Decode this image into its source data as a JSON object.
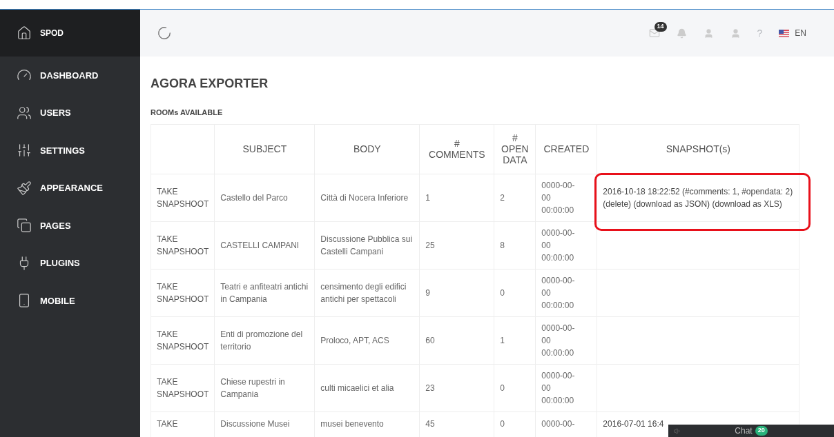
{
  "sidebar": {
    "brand": "SPOD",
    "items": [
      {
        "label": "DASHBOARD",
        "kind": "gauge"
      },
      {
        "label": "USERS",
        "kind": "users"
      },
      {
        "label": "SETTINGS",
        "kind": "sliders"
      },
      {
        "label": "APPEARANCE",
        "kind": "brush"
      },
      {
        "label": "PAGES",
        "kind": "pages"
      },
      {
        "label": "PLUGINS",
        "kind": "plug"
      },
      {
        "label": "MOBILE",
        "kind": "mobile"
      }
    ]
  },
  "topbar": {
    "mail_count": "14",
    "help": "?",
    "language": "EN"
  },
  "page": {
    "title": "AGORA EXPORTER",
    "section": "ROOMs AVAILABLE"
  },
  "table": {
    "columns": [
      [
        "SUBJECT"
      ],
      [
        "BODY"
      ],
      [
        "#",
        "COMMENTS"
      ],
      [
        "#",
        "OPEN",
        "DATA"
      ],
      [
        "CREATED"
      ],
      [
        "SNAPSHOT(s)"
      ]
    ],
    "rows": [
      {
        "action": [
          "TAKE",
          "SNAPSHOOT"
        ],
        "subject": "Castello del Parco",
        "body": "Città di Nocera Inferiore",
        "comments": "1",
        "open_data": "2",
        "created": [
          "0000-00-",
          "00",
          "00:00:00"
        ],
        "snapshot": "2016-10-18 18:22:52 (#comments: 1, #opendata: 2) (delete) (download as JSON) (download as XLS)",
        "highlighted": true
      },
      {
        "action": [
          "TAKE",
          "SNAPSHOOT"
        ],
        "subject": "CASTELLI CAMPANI",
        "body": "Discussione Pubblica sui Castelli Campani",
        "comments": "25",
        "open_data": "8",
        "created": [
          "0000-00-",
          "00",
          "00:00:00"
        ],
        "snapshot": "",
        "highlighted": false
      },
      {
        "action": [
          "TAKE",
          "SNAPSHOOT"
        ],
        "subject": "Teatri e anfiteatri antichi in Campania",
        "body": "censimento degli edifici antichi per spettacoli",
        "comments": "9",
        "open_data": "0",
        "created": [
          "0000-00-",
          "00",
          "00:00:00"
        ],
        "snapshot": "",
        "highlighted": false
      },
      {
        "action": [
          "TAKE",
          "SNAPSHOOT"
        ],
        "subject": "Enti di promozione del territorio",
        "body": "Proloco, APT, ACS",
        "comments": "60",
        "open_data": "1",
        "created": [
          "0000-00-",
          "00",
          "00:00:00"
        ],
        "snapshot": "",
        "highlighted": false
      },
      {
        "action": [
          "TAKE",
          "SNAPSHOOT"
        ],
        "subject": "Chiese rupestri in Campania",
        "body": "culti micaelici et alia",
        "comments": "23",
        "open_data": "0",
        "created": [
          "0000-00-",
          "00",
          "00:00:00"
        ],
        "snapshot": "",
        "highlighted": false
      },
      {
        "action": [
          "TAKE"
        ],
        "subject": "Discussione Musei",
        "body": "musei benevento",
        "comments": "45",
        "open_data": "0",
        "created": [
          "0000-00-"
        ],
        "snapshot": "2016-07-01 16:4",
        "highlighted": false
      }
    ]
  },
  "chat": {
    "label": "Chat",
    "count": "20"
  }
}
